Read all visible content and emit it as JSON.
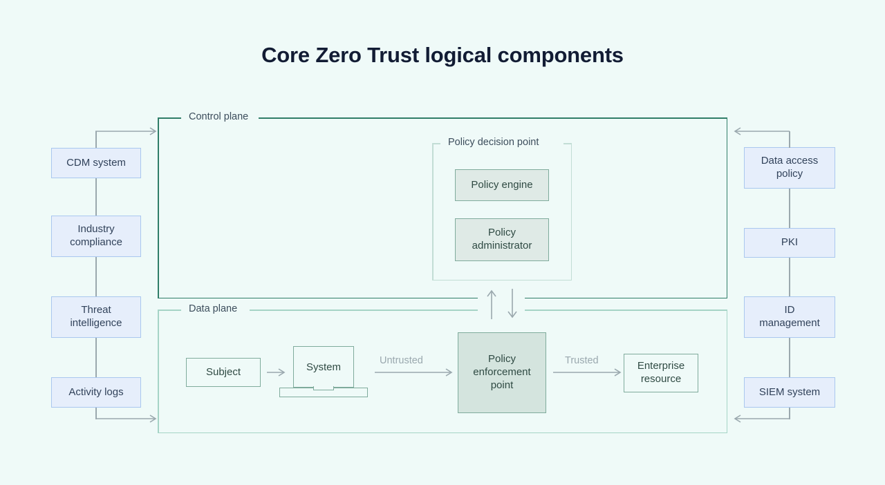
{
  "page": {
    "title": "Core Zero Trust logical components",
    "background_color": "#effaf8"
  },
  "colors": {
    "title_text": "#121c34",
    "blue_box_fill": "#e6eefb",
    "blue_box_border": "#a9c7ef",
    "green_box_fill": "#dfeae6",
    "green_box_fill_strong": "#d4e4de",
    "green_box_border": "#7fab9c",
    "control_plane_border": "#2f7d68",
    "data_plane_border": "#a5d4c6",
    "policy_decision_point_border": "#c2ddd5",
    "connector_line": "#9aa8ae",
    "flow_label_text": "#9aa8ae"
  },
  "left_column": {
    "items": [
      {
        "label": "CDM system"
      },
      {
        "label": "Industry\ncompliance"
      },
      {
        "label": "Threat\nintelligence"
      },
      {
        "label": "Activity logs"
      }
    ]
  },
  "right_column": {
    "items": [
      {
        "label": "Data access\npolicy"
      },
      {
        "label": "PKI"
      },
      {
        "label": "ID\nmanagement"
      },
      {
        "label": "SIEM system"
      }
    ]
  },
  "control_plane": {
    "label": "Control plane",
    "policy_decision_point": {
      "label": "Policy decision point",
      "components": [
        {
          "label": "Policy engine"
        },
        {
          "label": "Policy\nadministrator"
        }
      ]
    }
  },
  "data_plane": {
    "label": "Data plane",
    "nodes": [
      {
        "label": "Subject"
      },
      {
        "label": "System"
      },
      {
        "label": "Policy\nenforcement\npoint"
      },
      {
        "label": "Enterprise\nresource"
      }
    ],
    "flow_labels": [
      {
        "label": "Untrusted"
      },
      {
        "label": "Trusted"
      }
    ]
  },
  "plane_link": {
    "up_arrow": "↑",
    "down_arrow": "↓"
  }
}
